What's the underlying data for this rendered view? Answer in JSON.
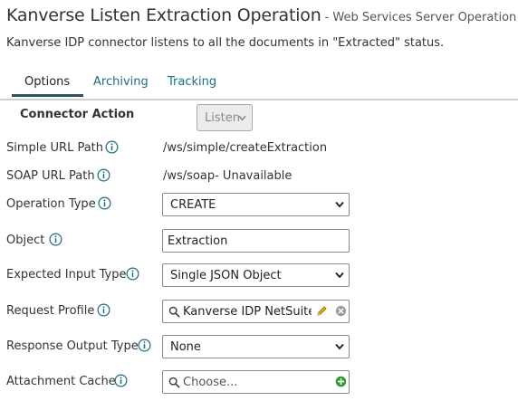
{
  "header": {
    "title": "Kanverse Listen Extraction Operation",
    "subtitle": "- Web Services Server Operation",
    "description": "Kanverse IDP connector listens to all the documents in \"Extracted\" status."
  },
  "tabs": [
    {
      "label": "Options",
      "active": true
    },
    {
      "label": "Archiving",
      "active": false
    },
    {
      "label": "Tracking",
      "active": false
    }
  ],
  "connector_action": {
    "label": "Connector Action",
    "value": "Listen"
  },
  "fields": {
    "simple_url_path": {
      "label": "Simple URL Path",
      "value": "/ws/simple/createExtraction"
    },
    "soap_url_path": {
      "label": "SOAP URL Path",
      "value": "/ws/soap- Unavailable"
    },
    "operation_type": {
      "label": "Operation Type",
      "value": "CREATE"
    },
    "object": {
      "label": "Object",
      "value": "Extraction"
    },
    "expected_input_type": {
      "label": "Expected Input Type",
      "value": "Single JSON Object"
    },
    "request_profile": {
      "label": "Request Profile",
      "value": "Kanverse IDP NetSuite J"
    },
    "response_output_type": {
      "label": "Response Output Type",
      "value": "None"
    },
    "attachment_cache": {
      "label": "Attachment Cache",
      "placeholder": "Choose..."
    }
  },
  "colors": {
    "tab_link": "#1a6f86",
    "info_icon": "#1f6c80",
    "edit_pencil": "#e0a800",
    "add_green": "#2a9a2a",
    "active_tab_underline": "#2d4f5e"
  },
  "icons": [
    "info-icon",
    "chevron-down-icon",
    "search-icon",
    "pencil-icon",
    "clear-icon",
    "add-icon"
  ]
}
